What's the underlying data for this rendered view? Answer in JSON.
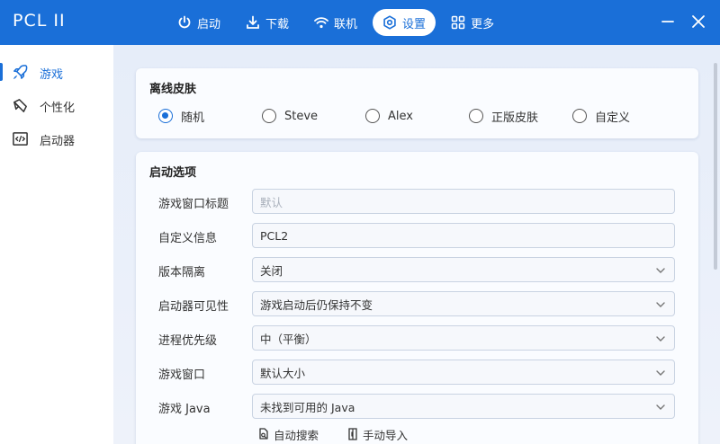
{
  "app": {
    "title": "PCL II"
  },
  "nav": [
    {
      "label": "启动",
      "icon": "power-icon"
    },
    {
      "label": "下载",
      "icon": "download-icon"
    },
    {
      "label": "联机",
      "icon": "wifi-icon"
    },
    {
      "label": "设置",
      "icon": "gear-icon",
      "active": true
    },
    {
      "label": "更多",
      "icon": "grid-icon"
    }
  ],
  "sidebar": {
    "items": [
      {
        "label": "游戏",
        "icon": "rocket-icon",
        "active": true
      },
      {
        "label": "个性化",
        "icon": "brush-icon"
      },
      {
        "label": "启动器",
        "icon": "code-window-icon"
      }
    ]
  },
  "skin": {
    "title": "离线皮肤",
    "options": [
      "随机",
      "Steve",
      "Alex",
      "正版皮肤",
      "自定义"
    ],
    "selected": "随机"
  },
  "launch": {
    "title": "启动选项",
    "rows": [
      {
        "label": "游戏窗口标题",
        "value": "",
        "placeholder": "默认",
        "type": "text"
      },
      {
        "label": "自定义信息",
        "value": "PCL2",
        "placeholder": "",
        "type": "text"
      },
      {
        "label": "版本隔离",
        "value": "关闭",
        "type": "select"
      },
      {
        "label": "启动器可见性",
        "value": "游戏启动后仍保持不变",
        "type": "select"
      },
      {
        "label": "进程优先级",
        "value": "中（平衡）",
        "type": "select"
      },
      {
        "label": "游戏窗口",
        "value": "默认大小",
        "type": "select"
      },
      {
        "label": "游戏 Java",
        "value": "未找到可用的 Java",
        "type": "select"
      }
    ],
    "auto_search": "自动搜索",
    "manual_import": "手动导入"
  },
  "colors": {
    "accent": "#1a6fd8",
    "background": "#e8eef8"
  }
}
